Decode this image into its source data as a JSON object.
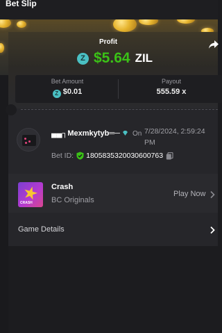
{
  "header": {
    "title": "Bet Slip"
  },
  "profit": {
    "label": "Profit",
    "amount": "$5.64",
    "currency": "ZIL",
    "currency_icon": "zil-coin-icon"
  },
  "stats": {
    "bet_amount_label": "Bet Amount",
    "bet_amount_value": "$0.01",
    "payout_label": "Payout",
    "payout_value": "555.59 x"
  },
  "bet": {
    "username": "▄▄┐Mexmkytyb═─",
    "on_label": "On",
    "date": "7/28/2024, 2:59:24 PM",
    "bet_id_label": "Bet ID:",
    "bet_id": "1805835320030600763"
  },
  "game": {
    "name": "Crash",
    "provider": "BC Originals",
    "thumb_label": "CRASH",
    "play_label": "Play Now"
  },
  "details": {
    "label": "Game Details"
  },
  "colors": {
    "profit_green": "#3bc117",
    "zil_teal": "#4ac0c3",
    "card_bg": "#26262a",
    "page_bg": "#1c1c1f"
  }
}
